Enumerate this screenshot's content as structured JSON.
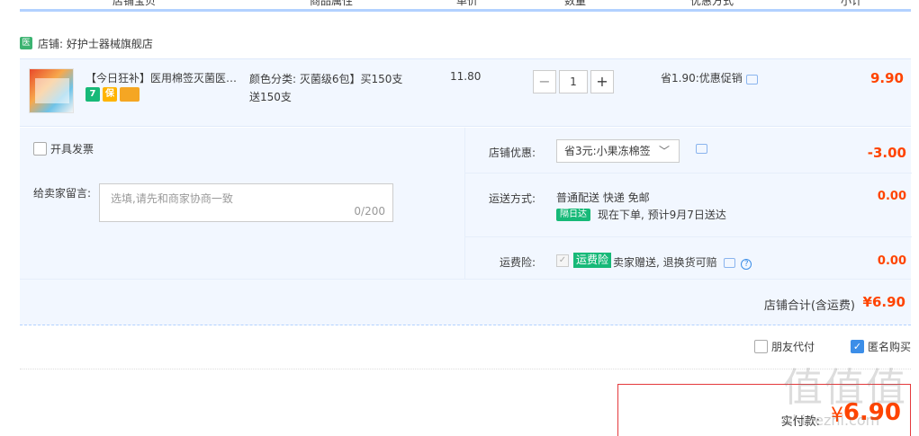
{
  "header": {
    "columns": [
      "店铺宝贝",
      "商品属性",
      "单价",
      "数量",
      "优惠方式",
      "小计"
    ]
  },
  "shop": {
    "icon_text": "医",
    "name": "店铺: 好护士器械旗舰店"
  },
  "item": {
    "title": "【今日狂补】医用棉签灭菌医药...",
    "badges": [
      "7",
      "保",
      ""
    ],
    "attribute": "颜色分类: 灭菌级6包】买150支送150支",
    "unit_price": "11.80",
    "qty_minus": "−",
    "qty_plus": "+",
    "quantity": "1",
    "promo": "省1.90:优惠促销",
    "subtotal": "9.90"
  },
  "invoice": {
    "label": "开具发票"
  },
  "memo": {
    "label": "给卖家留言:",
    "placeholder": "选填,请先和商家协商一致",
    "count": "0/200"
  },
  "discount": {
    "label": "店铺优惠:",
    "selected": "省3元:小果冻棉签",
    "chevron": "﹀",
    "amount": "-3.00"
  },
  "shipping": {
    "label": "运送方式:",
    "method": "普通配送 快递 免邮",
    "badge": "隔日达",
    "eta": "现在下单, 预计9月7日送达",
    "amount": "0.00"
  },
  "insurance": {
    "label": "运费险:",
    "check": "✓",
    "tag": "运费险",
    "text": "卖家赠送, 退换货可赔",
    "help": "?",
    "amount": "0.00"
  },
  "total": {
    "label": "店铺合计(含运费)",
    "value": "¥6.90"
  },
  "options": {
    "friend_pay": "朋友代付",
    "anonymous": "匿名购买",
    "anonymous_check": "✓"
  },
  "payment": {
    "label": "实付款:",
    "currency": "¥",
    "value": "6.90"
  },
  "watermark": {
    "text": "值值值",
    "url": "zhidezhi.com"
  }
}
